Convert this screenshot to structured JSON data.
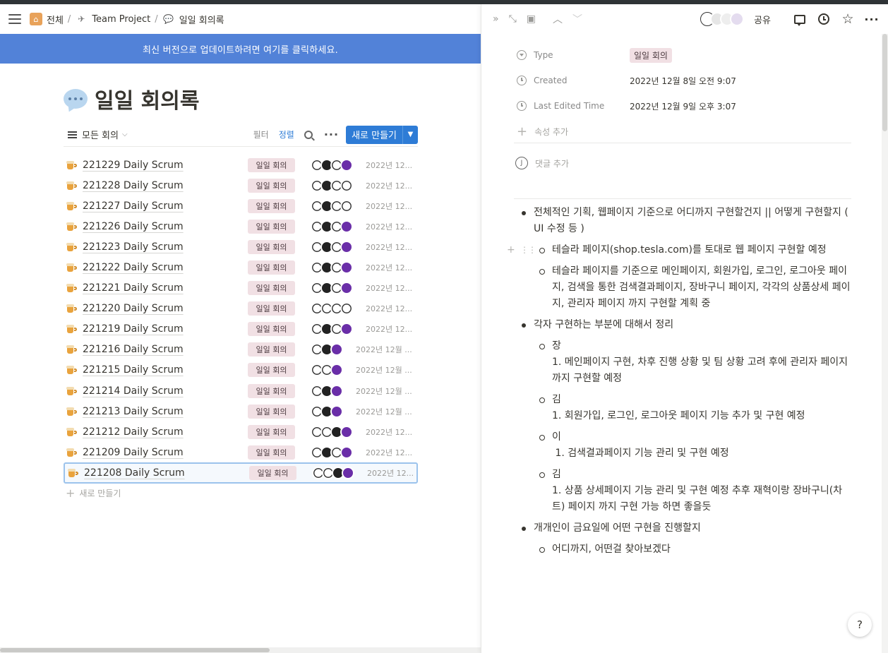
{
  "breadcrumb": {
    "items": [
      {
        "label": "전체",
        "icon": "home-icon"
      },
      {
        "label": "Team Project",
        "icon": "rocket-icon"
      },
      {
        "label": "일일 회의록",
        "icon": "speech-bubble-icon"
      }
    ],
    "separator": "/"
  },
  "banner": {
    "text": "최신 버전으로 업데이트하려면 여기를 클릭하세요."
  },
  "page": {
    "title": "일일 회의록",
    "icon": "speech-bubble-icon"
  },
  "view": {
    "name": "모든 회의",
    "filter_label": "필터",
    "sort_label": "정렬",
    "new_button": "새로 만들기",
    "add_row_label": "새로 만들기"
  },
  "rows": [
    {
      "title": "221229 Daily Scrum",
      "tag": "일일 회의",
      "date": "2022년 12...",
      "avatars": [
        "#fff",
        "#222",
        "#fff",
        "#6a2ea8"
      ]
    },
    {
      "title": "221228 Daily Scrum",
      "tag": "일일 회의",
      "date": "2022년 12...",
      "avatars": [
        "#fff",
        "#222",
        "#fff",
        "#fff"
      ]
    },
    {
      "title": "221227 Daily Scrum",
      "tag": "일일 회의",
      "date": "2022년 12...",
      "avatars": [
        "#fff",
        "#222",
        "#fff",
        "#fff"
      ]
    },
    {
      "title": "221226 Daily Scrum",
      "tag": "일일 회의",
      "date": "2022년 12...",
      "avatars": [
        "#fff",
        "#222",
        "#fff",
        "#6a2ea8"
      ]
    },
    {
      "title": "221223 Daily Scrum",
      "tag": "일일 회의",
      "date": "2022년 12...",
      "avatars": [
        "#fff",
        "#222",
        "#fff",
        "#6a2ea8"
      ]
    },
    {
      "title": "221222 Daily Scrum",
      "tag": "일일 회의",
      "date": "2022년 12...",
      "avatars": [
        "#fff",
        "#222",
        "#fff",
        "#6a2ea8"
      ]
    },
    {
      "title": "221221 Daily Scrum",
      "tag": "일일 회의",
      "date": "2022년 12...",
      "avatars": [
        "#fff",
        "#222",
        "#fff",
        "#6a2ea8"
      ]
    },
    {
      "title": "221220 Daily Scrum",
      "tag": "일일 회의",
      "date": "2022년 12...",
      "avatars": [
        "#fff",
        "#fff",
        "#fff",
        "#fff"
      ]
    },
    {
      "title": "221219 Daily Scrum",
      "tag": "일일 회의",
      "date": "2022년 12...",
      "avatars": [
        "#fff",
        "#222",
        "#fff",
        "#6a2ea8"
      ]
    },
    {
      "title": "221216 Daily Scrum",
      "tag": "일일 회의",
      "date": "2022년 12월 ...",
      "avatars": [
        "#fff",
        "#222",
        "#6a2ea8"
      ]
    },
    {
      "title": "221215 Daily Scrum",
      "tag": "일일 회의",
      "date": "2022년 12월 ...",
      "avatars": [
        "#fff",
        "#fff",
        "#6a2ea8"
      ]
    },
    {
      "title": "221214 Daily Scrum",
      "tag": "일일 회의",
      "date": "2022년 12월 ...",
      "avatars": [
        "#fff",
        "#222",
        "#6a2ea8"
      ]
    },
    {
      "title": "221213 Daily Scrum",
      "tag": "일일 회의",
      "date": "2022년 12월 ...",
      "avatars": [
        "#fff",
        "#222",
        "#6a2ea8"
      ]
    },
    {
      "title": "221212 Daily Scrum",
      "tag": "일일 회의",
      "date": "2022년 12...",
      "avatars": [
        "#fff",
        "#fff",
        "#222",
        "#6a2ea8"
      ]
    },
    {
      "title": "221209 Daily Scrum",
      "tag": "일일 회의",
      "date": "2022년 12...",
      "avatars": [
        "#fff",
        "#222",
        "#fff",
        "#6a2ea8"
      ]
    },
    {
      "title": "221208 Daily Scrum",
      "tag": "일일 회의",
      "date": "2022년 12...",
      "avatars": [
        "#fff",
        "#fff",
        "#222",
        "#6a2ea8"
      ],
      "selected": true
    }
  ],
  "side_panel": {
    "share_label": "공유",
    "properties": [
      {
        "name": "Type",
        "value": "일일 회의",
        "icon": "select-arrow-icon"
      },
      {
        "name": "Created",
        "value": "2022년 12월 8일 오전 9:07",
        "icon": "clock-icon"
      },
      {
        "name": "Last Edited Time",
        "value": "2022년 12월 9일 오후 3:07",
        "icon": "clock-icon"
      }
    ],
    "add_property": "속성 추가",
    "add_comment": "댓글 추가",
    "content": {
      "b1": "전체적인 기획, 웹페이지 기준으로 어디까지 구현할건지 || 어떻게 구현할지 ( UI 수정 등 )",
      "b1_1": "테슬라 페이지(shop.tesla.com)를 토대로 웹 페이지 구현할 예정",
      "b1_2": "테슬라 페이지를 기준으로 메인페이지,  회원가입, 로그인, 로그아웃 페이지,  검색을 통한 검색결과페이지, 장바구니 페이지, 각각의 상품상세 페이지, 관리자 페이지 까지 구현할 계획 중",
      "b2": "각자 구현하는 부분에 대해서 정리",
      "b2_1_name": "장",
      "b2_1_text": "1. 메인페이지 구현, 차후 진행 상황 및 팀 상황 고려 후에 관리자 페이지 까지 구현할 예정",
      "b2_2_name": "김",
      "b2_2_text": "1. 회원가입, 로그인, 로그아웃 페이지 기능 추가 및 구현 예정",
      "b2_3_name": "이",
      "b2_3_text": " 1. 검색결과페이지 기능 관리 및 구현 예정",
      "b2_4_name": "김",
      "b2_4_text": "1. 상품 상세페이지 기능 관리 및 구현 예정 추후 재혁이랑 장바구니(차트) 페이지 까지 구현 가능 하면 좋을듯",
      "b3": "개개인이 금요일에 어떤 구현을 진행할지",
      "b3_1": "어디까지, 어떤걸 찾아보겠다"
    },
    "help_label": "?"
  },
  "colors": {
    "accent": "#2e7cd6",
    "banner": "#5282d8",
    "tag_bg": "#f1e0e4"
  }
}
